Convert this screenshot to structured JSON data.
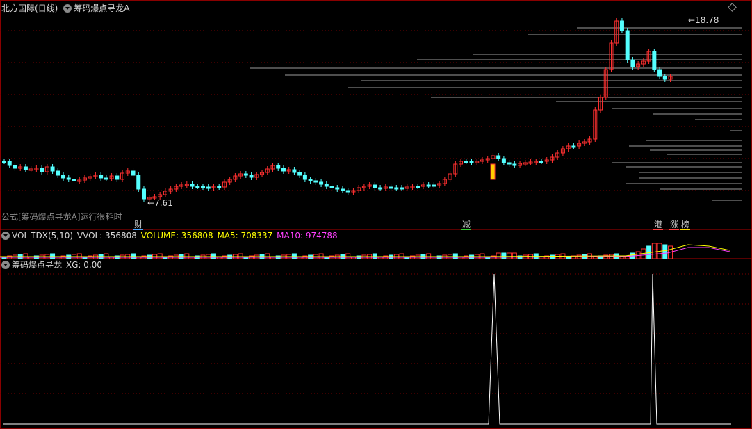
{
  "main_panel": {
    "stock_title": "北方国际(日线)",
    "indicator_name": "筹码爆点寻龙A",
    "formula_notice": "公式[筹码爆点寻龙A]运行很耗时",
    "high_label": "18.78",
    "low_label": "7.61",
    "event_tags": [
      {
        "text": "财",
        "color": "#4aa8ff"
      },
      {
        "text": "减",
        "color": "#36d036"
      },
      {
        "text": "港",
        "color": "#ff4040"
      },
      {
        "text": "涨",
        "color": "#ff4040"
      },
      {
        "text": "榜",
        "color": "#ffd800"
      }
    ]
  },
  "volume_panel": {
    "name": "VOL-TDX(5,10)",
    "vvol": "VVOL: 356808",
    "volume": "VOLUME: 356808",
    "ma5": "MA5: 708337",
    "ma10": "MA10: 974788",
    "colors": {
      "volume": "#ffff00",
      "ma5": "#ffff00",
      "ma10": "#ff40ff"
    }
  },
  "signal_panel": {
    "name": "筹码爆点寻龙",
    "xg": "XG: 0.00"
  },
  "colors": {
    "up": "#ff3030",
    "down": "#54ffff",
    "grid": "#7a0000",
    "chip": "#b8b8b8"
  }
}
